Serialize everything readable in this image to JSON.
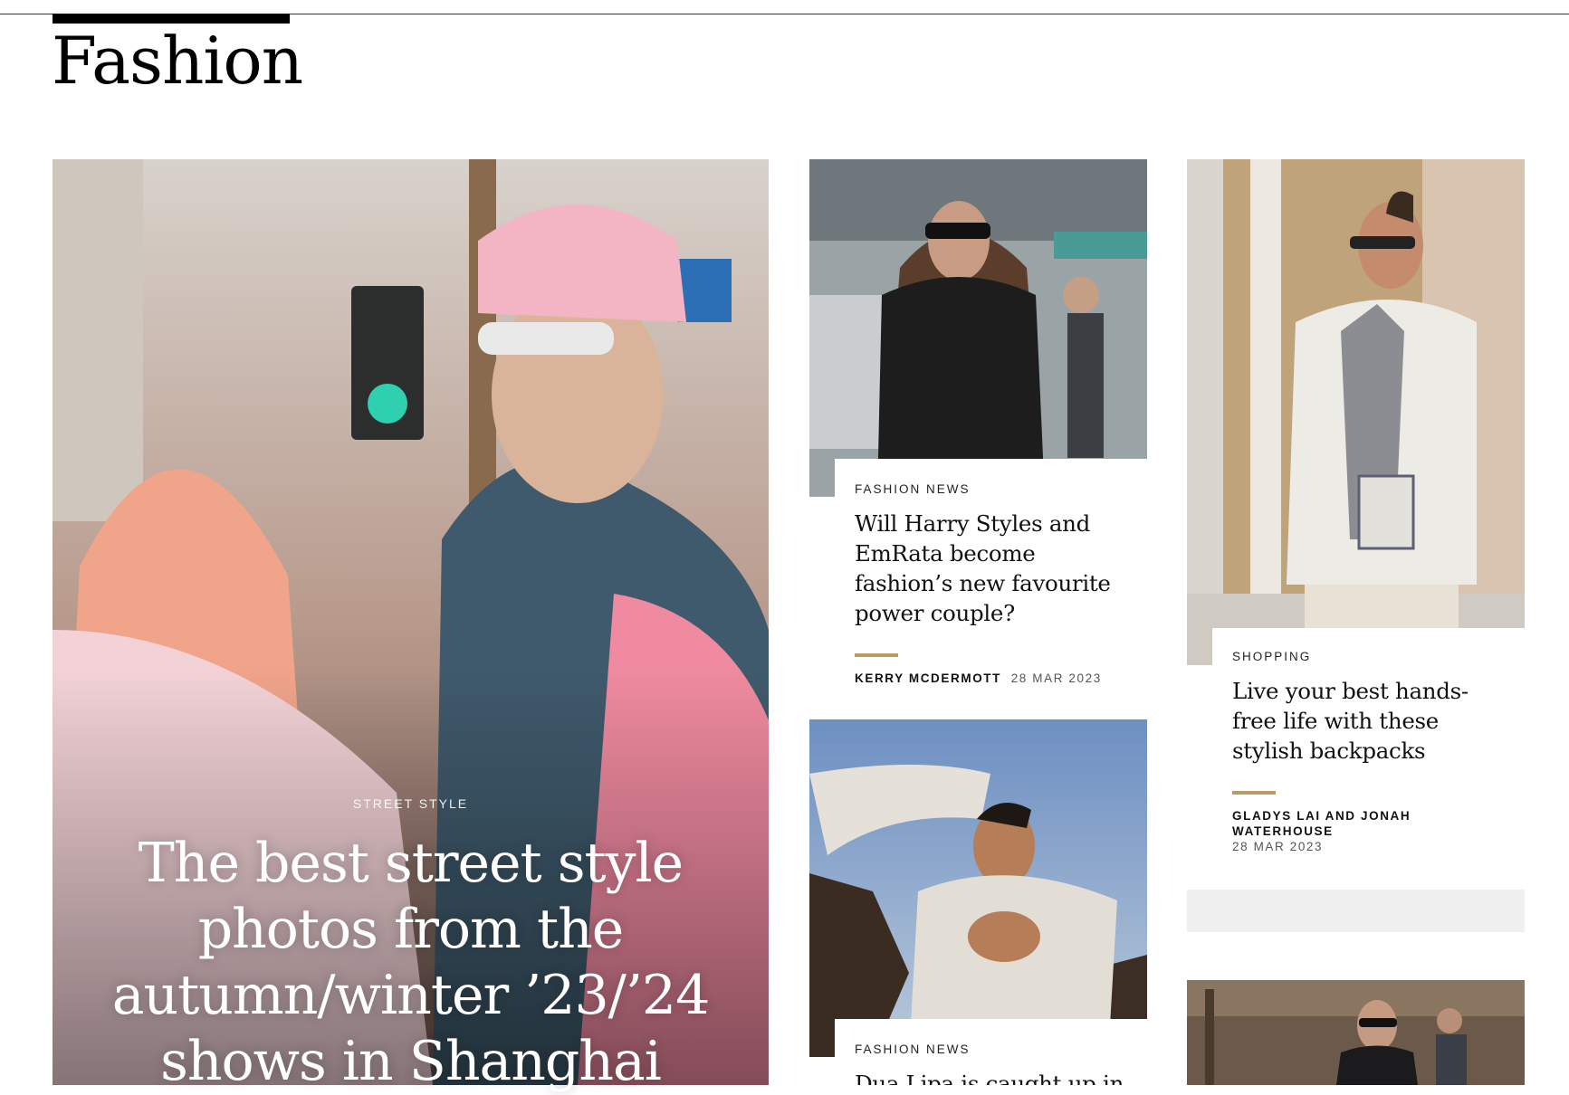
{
  "section": {
    "title": "Fashion"
  },
  "hero": {
    "category": "STREET STYLE",
    "headline": "The best street style photos from the autumn/winter ’23/’24 shows in Shanghai"
  },
  "articles": [
    {
      "category": "FASHION NEWS",
      "headline": "Will Harry Styles and EmRata become fashion’s new favourite power couple?",
      "author": "KERRY MCDERMOTT",
      "date": "28 MAR 2023"
    },
    {
      "category": "SHOPPING",
      "headline": "Live your best hands-free life with these stylish backpacks",
      "author": "GLADYS LAI AND JONAH WATERHOUSE",
      "date": "28 MAR 2023"
    },
    {
      "category": "FASHION NEWS",
      "headline": "Dua Lipa is caught up in her"
    }
  ],
  "colors": {
    "accent_rule": "#b79b68",
    "ad_placeholder": "#f0f0f0"
  }
}
